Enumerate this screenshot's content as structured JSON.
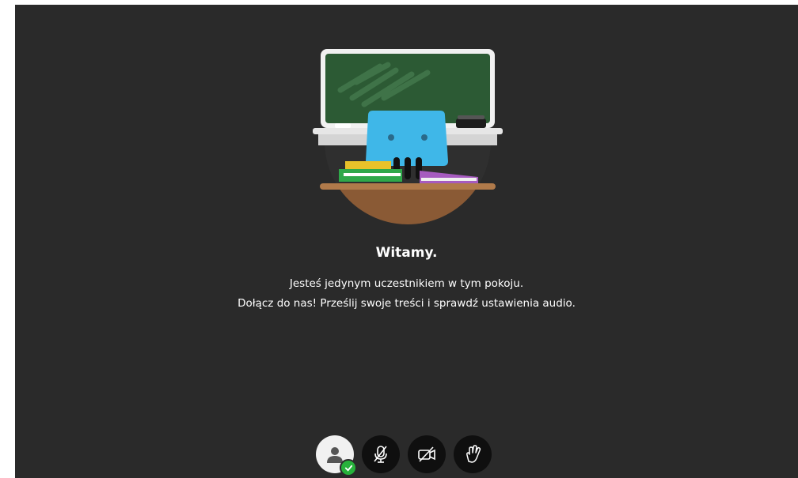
{
  "welcome": {
    "title": "Witamy.",
    "line1": "Jesteś jedynym uczestnikiem w tym pokoju.",
    "line2": "Dołącz do nas! Prześlij swoje treści i sprawdź ustawienia audio."
  },
  "controls": [
    {
      "name": "user-avatar",
      "icon": "user-icon",
      "status": "connected"
    },
    {
      "name": "microphone-muted",
      "icon": "mic-off-icon"
    },
    {
      "name": "camera-off",
      "icon": "camera-off-icon"
    },
    {
      "name": "raise-hand",
      "icon": "hand-icon"
    }
  ],
  "colors": {
    "background": "#2a2a2a",
    "button": "#0f0f0f",
    "status_ok": "#27b23b"
  }
}
